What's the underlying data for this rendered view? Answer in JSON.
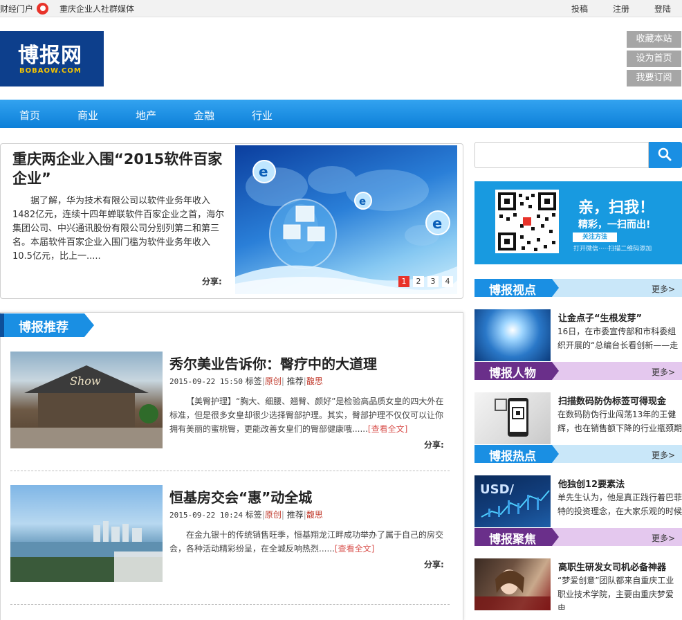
{
  "topbar": {
    "portal": "财经门户",
    "media": "重庆企业人社群媒体",
    "submit": "投稿",
    "register": "注册",
    "login": "登陆"
  },
  "logo": {
    "cn": "博报网",
    "en": "BOBAOW.COM"
  },
  "side_buttons": [
    "收藏本站",
    "设为首页",
    "我要订阅"
  ],
  "nav": [
    "首页",
    "商业",
    "地产",
    "金融",
    "行业"
  ],
  "feature": {
    "title": "重庆两企业入围“2015软件百家企业”",
    "body": "据了解，华为技术有限公司以软件业务年收入1482亿元，连续十四年蝉联软件百家企业之首，海尔集团公司、中兴通讯股份有限公司分别列第二和第三名。本届软件百家企业入围门槛为软件业务年收入10.5亿元，比上一.....",
    "share": "分享:",
    "pages": [
      "1",
      "2",
      "3",
      "4"
    ]
  },
  "qr_banner": {
    "line1": "亲，扫我！",
    "line2": "精彩，一扫而出!",
    "tag": "关注方法",
    "hint": "打开微信·····扫描二维码添加"
  },
  "sections": [
    {
      "label": "博报视点",
      "more": "更多>",
      "item": {
        "title": "让金点子“生根发芽”",
        "text": "16日，在市委宣传部和市科委组织开展的“总编台长看创新——走"
      }
    },
    {
      "label": "博报人物",
      "more": "更多>",
      "item": {
        "title": "扫描数码防伪标签可得现金",
        "text": "在数码防伪行业闯荡13年的王健辉，也在销售额下降的行业瓶颈期"
      }
    },
    {
      "label": "博报热点",
      "more": "更多>",
      "item": {
        "title": "他独创12要素法",
        "text": "单先生认为，他是真正践行着巴菲特的投资理念，在大家乐观的时候"
      }
    },
    {
      "label": "博报聚焦",
      "more": "更多>",
      "item": {
        "title": "高职生研发女司机必备神器",
        "text": "“梦爱创意”团队都来自重庆工业职业技术学院，主要由重庆梦爱电....."
      }
    }
  ],
  "recommend": {
    "label": "博报推荐",
    "articles": [
      {
        "title": "秀尔美业告诉你：臀疗中的大道理",
        "date": "2015-09-22 15:50",
        "tags_label": "标签",
        "tag1": "原创",
        "rec_label": "推荐",
        "tag2": "馥思",
        "summary": "【美臀护理】“胸大、细腰、翘臀、颜好”是检验高品质女皇的四大外在标准，但是很多女皇却很少选择臀部护理。其实，臀部护理不仅仅可以让你拥有美丽的蜜桃臀，更能改善女皇们的臀部健康哦......",
        "more": "[查看全文]",
        "share": "分享:"
      },
      {
        "title": "恒基房交会“惠”动全城",
        "date": "2015-09-22 10:24",
        "tags_label": "标签",
        "tag1": "原创",
        "rec_label": "推荐",
        "tag2": "馥思",
        "summary": "在金九银十的传统销售旺季，恒基翔龙江畔成功举办了属于自己的房交会，各种活动精彩纷呈，在全城反响热烈......",
        "more": "[查看全文]",
        "share": "分享:"
      }
    ]
  },
  "colors": {
    "brand_blue": "#1a8fe3",
    "logo_navy": "#0d3f8c",
    "accent_red": "#e8332a",
    "section_purple": "#6a2f8a"
  }
}
